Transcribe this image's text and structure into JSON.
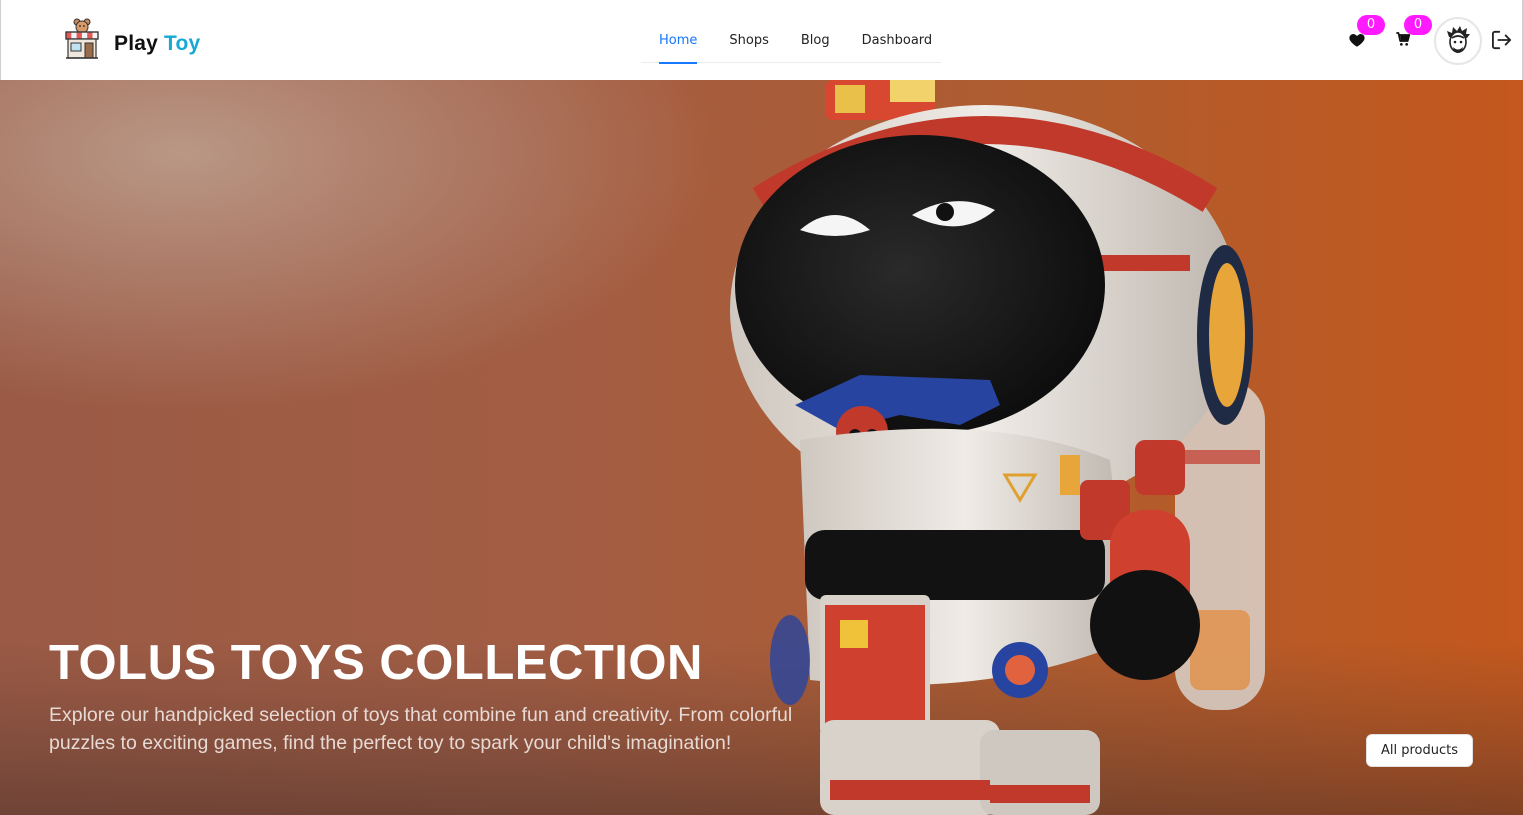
{
  "brand": {
    "name_first": "Play",
    "name_second": "Toy",
    "accent_color": "#17a9d6",
    "logo_icon": "toy-shop-icon"
  },
  "nav": {
    "items": [
      {
        "label": "Home",
        "active": true
      },
      {
        "label": "Shops",
        "active": false
      },
      {
        "label": "Blog",
        "active": false
      },
      {
        "label": "Dashboard",
        "active": false
      }
    ],
    "active_color": "#1677ff"
  },
  "header_actions": {
    "wishlist": {
      "icon": "heart-icon",
      "count": "0"
    },
    "cart": {
      "icon": "cart-icon",
      "count": "0"
    },
    "badge_color": "#ff1aff",
    "avatar_icon": "user-avatar-icon",
    "logout_icon": "logout-icon"
  },
  "hero": {
    "title": "TOLUS TOYS COLLECTION",
    "description": "Explore our handpicked selection of toys that combine fun and creativity. From colorful puzzles to exciting games, find the perfect toy to spark your child's imagination!",
    "button_label": "All products",
    "image": "astronaut-toy-figure-image"
  }
}
